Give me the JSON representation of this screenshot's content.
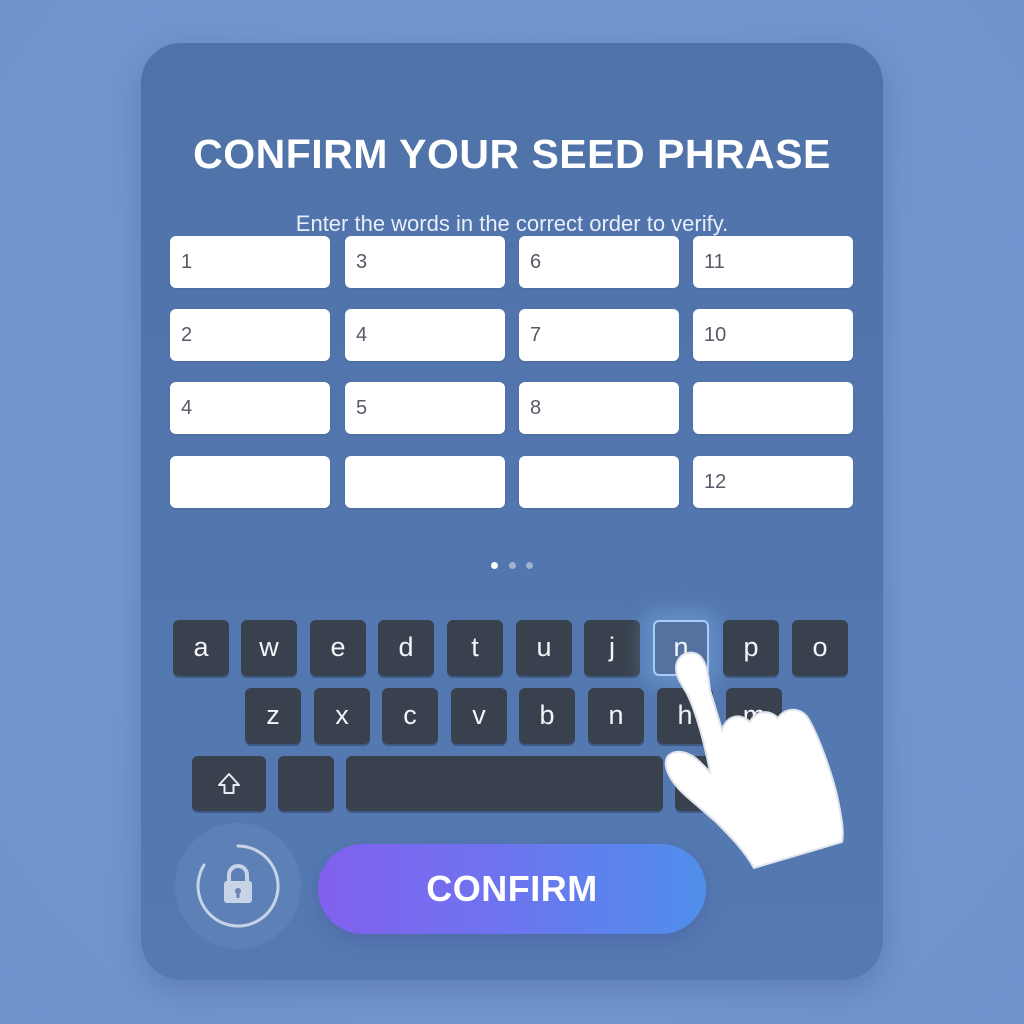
{
  "title": "CONFIRM YOUR SEED PHRASE",
  "subtitle": "Enter the words in the correct order to verify.",
  "slots": [
    "1",
    "3",
    "6",
    "11",
    "2",
    "4",
    "7",
    "10",
    "4",
    "5",
    "8",
    "",
    "",
    "",
    "",
    "12"
  ],
  "pagination": {
    "count": 3,
    "active": 1
  },
  "keyboard": {
    "row1": [
      "a",
      "w",
      "e",
      "d",
      "t",
      "u",
      "j",
      "n",
      "p",
      "o"
    ],
    "row2": [
      "z",
      "x",
      "c",
      "v",
      "b",
      "n",
      "h",
      "m"
    ],
    "highlighted_key": "n"
  },
  "confirm_label": "CONFIRM",
  "colors": {
    "background": "#7497cf",
    "card": "#5174ab",
    "key": "#3a414e",
    "button_start": "#8160ee",
    "button_end": "#4f8feb"
  },
  "icons": {
    "lock": "lock-icon",
    "shift": "shift-arrow-icon",
    "hand": "pointing-hand-icon"
  }
}
